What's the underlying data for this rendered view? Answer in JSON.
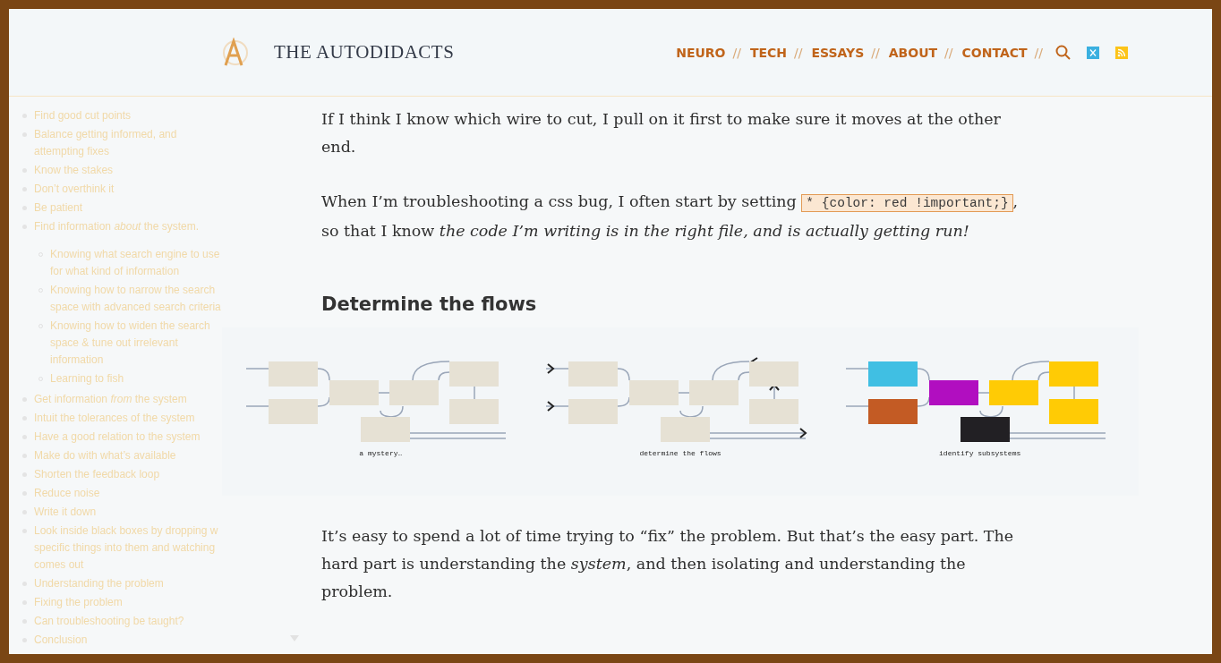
{
  "site": {
    "title": "THE AUTODIDACTS"
  },
  "nav": {
    "links": [
      {
        "label": "NEURO",
        "separator": "//"
      },
      {
        "label": "TECH",
        "separator": "//"
      },
      {
        "label": "ESSAYS",
        "separator": "//"
      },
      {
        "label": "ABOUT",
        "separator": "//"
      },
      {
        "label": "CONTACT",
        "separator": "//"
      }
    ]
  },
  "sidebar": {
    "items": [
      {
        "text": "Find good cut points"
      },
      {
        "text": "Balance getting informed, and attempting fixes"
      },
      {
        "text": "Know the stakes"
      },
      {
        "text": "Don’t overthink it"
      },
      {
        "text": "Be patient"
      },
      {
        "text": "Find information *about* the system.",
        "children": [
          {
            "text": "Knowing what search engine to use for what kind of information"
          },
          {
            "text": "Knowing how to narrow the search space with advanced search criteria"
          },
          {
            "text": "Knowing how to widen the search space & tune out irrelevant information"
          },
          {
            "text": "Learning to fish"
          }
        ]
      },
      {
        "text": "Get information *from* the system"
      },
      {
        "text": "Intuit the tolerances of the system"
      },
      {
        "text": "Have a good relation to the system"
      },
      {
        "text": "Make do with what’s available"
      },
      {
        "text": "Shorten the feedback loop"
      },
      {
        "text": "Reduce noise"
      },
      {
        "text": "Write it down"
      },
      {
        "text": "Look inside black boxes by dropping w specific things into them and watching comes out"
      },
      {
        "text": "Understanding the problem"
      },
      {
        "text": "Fixing the problem"
      },
      {
        "text": "Can troubleshooting be taught?"
      },
      {
        "text": "Conclusion"
      }
    ]
  },
  "article": {
    "blocks": [
      {
        "kind": "paragraph",
        "parts": [
          {
            "kind": "text",
            "text": "If I think I know which wire to cut, I pull on it first to make sure it moves at the other end."
          }
        ]
      },
      {
        "kind": "paragraph",
        "parts": [
          {
            "kind": "text",
            "text": "When I’m troubleshooting a css bug, I often start by setting "
          },
          {
            "kind": "code",
            "text": "* {color: red !important;}"
          },
          {
            "kind": "text",
            "text": ", so that I know *the code I’m writing is in the right file, and is actually getting run!*"
          }
        ]
      },
      {
        "kind": "heading",
        "text": "Determine the flows"
      },
      {
        "kind": "figure",
        "panels": [
          {
            "kind": "mystery",
            "caption": "a mystery…"
          },
          {
            "kind": "flows",
            "caption": "determine the flows"
          },
          {
            "kind": "subsystems",
            "caption": "identify subsystems"
          }
        ]
      },
      {
        "kind": "paragraph",
        "parts": [
          {
            "kind": "text",
            "text": "It’s easy to spend a lot of time trying to “fix” the problem. But that’s the easy part. The hard part is understanding the *system*, and then isolating and understanding the problem."
          }
        ]
      }
    ]
  }
}
